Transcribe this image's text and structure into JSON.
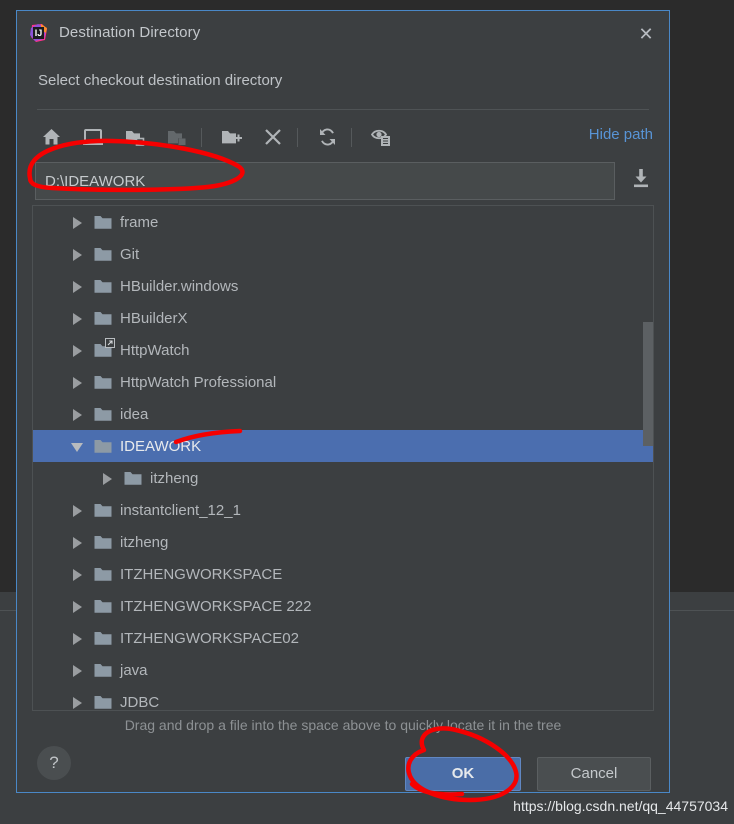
{
  "dialog": {
    "title": "Destination Directory",
    "close_label": "✕",
    "subtitle": "Select checkout destination directory",
    "app_icon": "intellij-idea-icon"
  },
  "toolbar": {
    "buttons": [
      {
        "name": "home-icon",
        "tooltip": "Home"
      },
      {
        "name": "desktop-icon",
        "tooltip": "Desktop"
      },
      {
        "name": "project-folder-icon",
        "tooltip": "Project Directory"
      },
      {
        "name": "module-folder-icon",
        "tooltip": "Module Directory"
      },
      {
        "name": "new-folder-icon",
        "tooltip": "New Folder"
      },
      {
        "name": "delete-icon",
        "tooltip": "Delete"
      },
      {
        "name": "refresh-icon",
        "tooltip": "Refresh"
      },
      {
        "name": "show-hidden-files-icon",
        "tooltip": "Show Hidden Files and Directories"
      }
    ],
    "hide_path_label": "Hide path"
  },
  "path": {
    "value": "D:\\IDEAWORK",
    "placeholder": "",
    "import_icon": "download-into-icon"
  },
  "tree": {
    "rows": [
      {
        "label": "frame",
        "indent": 0,
        "expanded": false,
        "selected": false,
        "link": false
      },
      {
        "label": "Git",
        "indent": 0,
        "expanded": false,
        "selected": false,
        "link": false
      },
      {
        "label": "HBuilder.windows",
        "indent": 0,
        "expanded": false,
        "selected": false,
        "link": false
      },
      {
        "label": "HBuilderX",
        "indent": 0,
        "expanded": false,
        "selected": false,
        "link": false
      },
      {
        "label": "HttpWatch",
        "indent": 0,
        "expanded": false,
        "selected": false,
        "link": true
      },
      {
        "label": "HttpWatch Professional",
        "indent": 0,
        "expanded": false,
        "selected": false,
        "link": false
      },
      {
        "label": "idea",
        "indent": 0,
        "expanded": false,
        "selected": false,
        "link": false
      },
      {
        "label": "IDEAWORK",
        "indent": 0,
        "expanded": true,
        "selected": true,
        "link": false
      },
      {
        "label": "itzheng",
        "indent": 1,
        "expanded": false,
        "selected": false,
        "link": false
      },
      {
        "label": "instantclient_12_1",
        "indent": 0,
        "expanded": false,
        "selected": false,
        "link": false
      },
      {
        "label": "itzheng",
        "indent": 0,
        "expanded": false,
        "selected": false,
        "link": false
      },
      {
        "label": "ITZHENGWORKSPACE",
        "indent": 0,
        "expanded": false,
        "selected": false,
        "link": false
      },
      {
        "label": "ITZHENGWORKSPACE 222",
        "indent": 0,
        "expanded": false,
        "selected": false,
        "link": false
      },
      {
        "label": "ITZHENGWORKSPACE02",
        "indent": 0,
        "expanded": false,
        "selected": false,
        "link": false
      },
      {
        "label": "java",
        "indent": 0,
        "expanded": false,
        "selected": false,
        "link": false
      },
      {
        "label": "JDBC",
        "indent": 0,
        "expanded": false,
        "selected": false,
        "link": false
      }
    ]
  },
  "hint": "Drag and drop a file into the space above to quickly locate it in the tree",
  "footer": {
    "help_label": "?",
    "ok_label": "OK",
    "cancel_label": "Cancel"
  },
  "watermark": "https://blog.csdn.net/qq_44757034",
  "colors": {
    "dialog_border": "#4a88c7",
    "selection": "#4b6eaf",
    "link": "#5894d6",
    "ok_button": "#4a6da7",
    "annotation": "#f50000",
    "panel_bg": "#3c3f41",
    "ide_bg": "#2b2b2b"
  }
}
